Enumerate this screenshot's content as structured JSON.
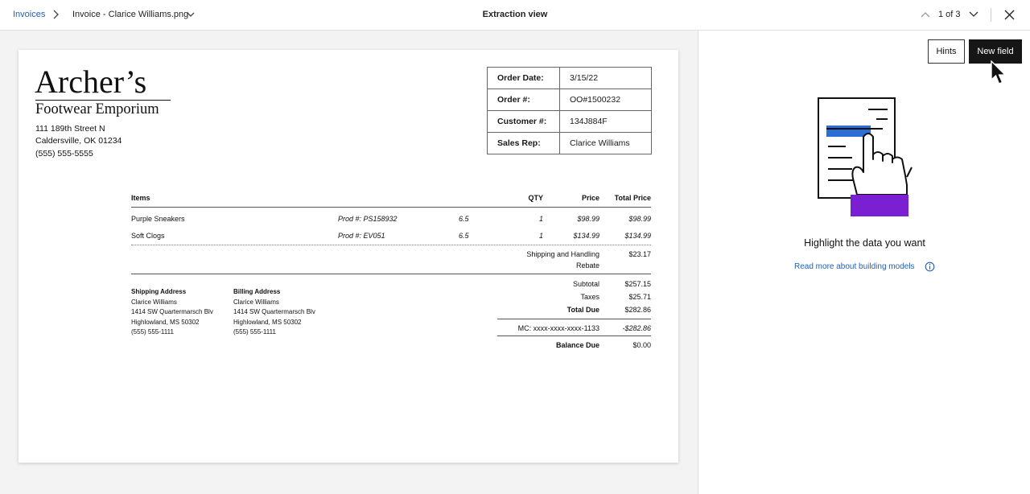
{
  "header": {
    "breadcrumb_root": "Invoices",
    "file_name": "Invoice - Clarice Williams.png",
    "view_title": "Extraction view",
    "pager": "1 of 3"
  },
  "invoice": {
    "logo_name": "Archer’s",
    "logo_subtitle": "Footwear Emporium",
    "address": [
      "111 189th Street N",
      "Caldersville, OK 01234",
      "(555) 555-5555"
    ],
    "order_info": [
      {
        "label": "Order Date:",
        "value": "3/15/22"
      },
      {
        "label": "Order #:",
        "value": "OO#1500232"
      },
      {
        "label": "Customer #:",
        "value": "134J884F"
      },
      {
        "label": "Sales Rep:",
        "value": "Clarice Williams"
      }
    ],
    "columns": {
      "items": "Items",
      "qty": "QTY",
      "price": "Price",
      "total": "Total Price"
    },
    "rows": [
      {
        "item": "Purple Sneakers",
        "prod": "Prod #: PS158932",
        "size": "6.5",
        "qty": "1",
        "price": "$98.99",
        "total": "$98.99"
      },
      {
        "item": "Soft Clogs",
        "prod": "Prod #: EV051",
        "size": "6.5",
        "qty": "1",
        "price": "$134.99",
        "total": "$134.99"
      }
    ],
    "shipping_label": "Shipping and Handling",
    "shipping_value": "$23.17",
    "rebate_label": "Rebate",
    "shipping_address": {
      "title": "Shipping Address",
      "lines": [
        "Clarice Williams",
        "1414 SW Quartermarsch Blv",
        "Highlowland, MS 50302",
        "(555) 555-1111"
      ]
    },
    "billing_address": {
      "title": "Billing Address",
      "lines": [
        "Clarice Williams",
        "1414 SW Quartermarsch Blv",
        "Highlowland, MS 50302",
        "(555) 555-1111"
      ]
    },
    "summary": {
      "subtotal_label": "Subtotal",
      "subtotal": "$257.15",
      "taxes_label": "Taxes",
      "taxes": "$25.71",
      "total_due_label": "Total Due",
      "total_due": "$282.86",
      "payment_label": "MC: xxxx-xxxx-xxxx-1133",
      "payment": "-$282.86",
      "balance_label": "Balance Due",
      "balance": "$0.00"
    }
  },
  "side_panel": {
    "hints_label": "Hints",
    "new_field_label": "New field",
    "title": "Highlight the data you want",
    "link": "Read more about building models"
  },
  "colors": {
    "accent_link": "#1f5fbf",
    "highlight_blue": "#2b6fd6",
    "purple": "#7a1fd1",
    "dark_button": "#161616"
  }
}
